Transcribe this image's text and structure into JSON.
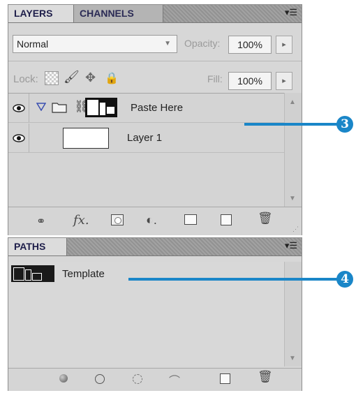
{
  "layers_panel": {
    "tabs": [
      {
        "label": "LAYERS"
      },
      {
        "label": "CHANNELS"
      }
    ],
    "menu_icon": "panel-menu-icon",
    "blend_mode": "Normal",
    "opacity_label": "Opacity:",
    "opacity_value": "100%",
    "lock_label": "Lock:",
    "fill_label": "Fill:",
    "fill_value": "100%",
    "layers": [
      {
        "name": "Paste Here",
        "type": "group-with-mask",
        "visible": true
      },
      {
        "name": "Layer 1",
        "type": "pixel-layer",
        "visible": true
      }
    ],
    "footer_icons": [
      "link-layers-icon",
      "fx-icon",
      "add-mask-icon",
      "adjustment-layer-icon",
      "new-group-icon",
      "new-layer-icon",
      "delete-icon"
    ]
  },
  "paths_panel": {
    "tab": "PATHS",
    "paths": [
      {
        "name": "Template"
      }
    ],
    "footer_icons": [
      "fill-path-icon",
      "stroke-path-icon",
      "load-selection-icon",
      "make-work-path-icon",
      "new-path-icon",
      "delete-path-icon"
    ]
  },
  "callouts": [
    {
      "number": "3"
    },
    {
      "number": "4"
    }
  ],
  "colors": {
    "callout": "#1a86c8",
    "panel": "#d7d7d7",
    "tab_text": "#1e1e4a"
  }
}
